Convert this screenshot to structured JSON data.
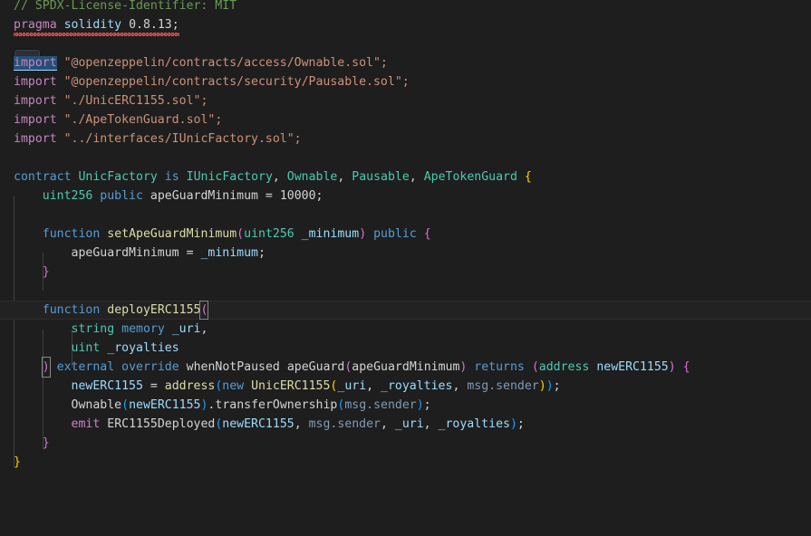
{
  "editor": {
    "language": "solidity",
    "theme": "dark-plus",
    "background_color": "#1e1e1e",
    "foreground_color": "#d4d4d4",
    "active_line_number": 17,
    "accent_colors": {
      "comment": "#6a9955",
      "keyword": "#c586c0",
      "control": "#569cd6",
      "type": "#4ec9b0",
      "string": "#ce9178",
      "function": "#dcdcaa",
      "parameter": "#9cdcfe",
      "member": "#7f9bb5",
      "bracket_level_1": "#ffd700",
      "bracket_level_2": "#da70d6",
      "bracket_level_3": "#179fff",
      "error_squiggle": "#e05252",
      "link_hover_background": "#264f78",
      "active_line_background": "#222222"
    }
  },
  "code": {
    "line_01": {
      "comment": "// SPDX-License-Identifier: MIT"
    },
    "line_02": {
      "pragma": "pragma",
      "solidity": "solidity",
      "version": "0.8.13",
      "semicolon": ";"
    },
    "line_04": {
      "import": "import",
      "path": "\"@openzeppelin/contracts/access/Ownable.sol\";"
    },
    "line_05": {
      "import": "import",
      "path": "\"@openzeppelin/contracts/security/Pausable.sol\";"
    },
    "line_06": {
      "import": "import",
      "path": "\"./UnicERC1155.sol\";"
    },
    "line_07": {
      "import": "import",
      "path": "\"./ApeTokenGuard.sol\";"
    },
    "line_08": {
      "import": "import",
      "path": "\"../interfaces/IUnicFactory.sol\";"
    },
    "line_10": {
      "contract_kw": "contract",
      "contract_name": "UnicFactory",
      "is_kw": "is",
      "base_1": "IUnicFactory",
      "comma_1": ", ",
      "base_2": "Ownable",
      "comma_2": ", ",
      "base_3": "Pausable",
      "comma_3": ", ",
      "base_4": "ApeTokenGuard",
      "open_brace": " {"
    },
    "line_11": {
      "type": "uint256",
      "visibility": "public",
      "name": "apeGuardMinimum",
      "assign": " = ",
      "value": "10000",
      "semicolon": ";"
    },
    "line_13": {
      "function_kw": "function",
      "name": "setApeGuardMinimum",
      "open_paren": "(",
      "param_type": "uint256",
      "param_name": "_minimum",
      "close_paren": ")",
      "visibility": "public",
      "open_brace": "{"
    },
    "line_14": {
      "lhs": "apeGuardMinimum",
      "assign": " = ",
      "rhs": "_minimum",
      "semicolon": ";"
    },
    "line_15": {
      "close_brace": "}"
    },
    "line_17": {
      "function_kw": "function",
      "name": "deployERC1155",
      "open_paren": "("
    },
    "line_18": {
      "type": "string",
      "location": "memory",
      "name": "_uri",
      "comma": ","
    },
    "line_19": {
      "type": "uint",
      "name": "_royalties"
    },
    "line_20": {
      "close_paren": ")",
      "external": "external",
      "override": "override",
      "modifier_1": "whenNotPaused",
      "modifier_2": "apeGuard",
      "modifier_2_open": "(",
      "modifier_2_arg": "apeGuardMinimum",
      "modifier_2_close": ")",
      "returns_kw": "returns",
      "returns_open": "(",
      "returns_type": "address",
      "returns_name": "newERC1155",
      "returns_close": ")",
      "open_brace": "{"
    },
    "line_21": {
      "lhs": "newERC1155",
      "assign": " = ",
      "call": "address",
      "open_1": "(",
      "new_kw": "new",
      "ctor": "UnicERC1155",
      "open_2": "(",
      "arg_1": "_uri",
      "comma_1": ", ",
      "arg_2": "_royalties",
      "comma_2": ", ",
      "arg_3": "msg.sender",
      "close_2": ")",
      "close_1": ")",
      "semicolon": ";"
    },
    "line_22": {
      "cast": "Ownable",
      "open_1": "(",
      "cast_arg": "newERC1155",
      "close_1": ")",
      "dot": ".",
      "method": "transferOwnership",
      "open_2": "(",
      "arg": "msg.sender",
      "close_2": ")",
      "semicolon": ";"
    },
    "line_23": {
      "emit_kw": "emit",
      "event": "ERC1155Deployed",
      "open": "(",
      "arg_1": "newERC1155",
      "comma_1": ", ",
      "arg_2": "msg.sender",
      "comma_2": ", ",
      "arg_3": "_uri",
      "comma_3": ", ",
      "arg_4": "_royalties",
      "close": ")",
      "semicolon": ";"
    },
    "line_24": {
      "close_brace": "}"
    },
    "line_25": {
      "close_brace": "}"
    }
  }
}
